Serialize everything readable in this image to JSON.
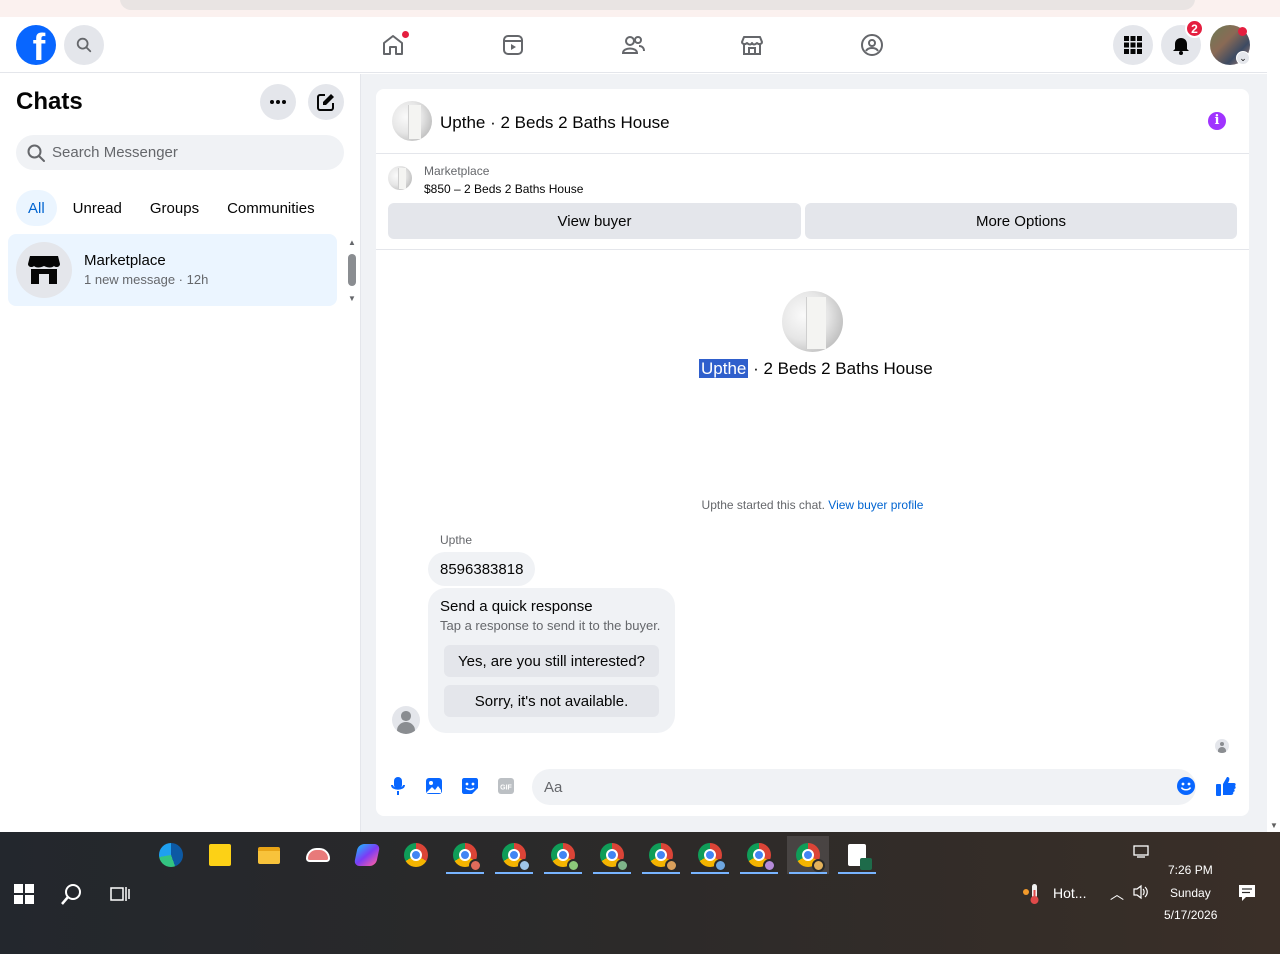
{
  "topnav": {
    "notification_count": "2"
  },
  "chats": {
    "title": "Chats",
    "search_placeholder": "Search Messenger",
    "filters": [
      "All",
      "Unread",
      "Groups",
      "Communities"
    ],
    "active_filter": "All",
    "items": [
      {
        "name": "Marketplace",
        "preview": "1 new message",
        "time": "12h"
      }
    ]
  },
  "conversation": {
    "title": "Upthe · 2 Beds 2 Baths House",
    "banner": {
      "label": "Marketplace",
      "listing": "$850 – 2 Beds 2 Baths House",
      "view_buyer": "View buyer",
      "more_options": "More Options"
    },
    "center": {
      "name_highlight": "Upthe",
      "name_rest": " · 2 Beds 2 Baths House"
    },
    "started_text": "Upthe started this chat.",
    "started_link": "View buyer profile",
    "sender": "Upthe",
    "message": "8596383818",
    "quick": {
      "title": "Send a quick response",
      "subtitle": "Tap a response to send it to the buyer.",
      "option1": "Yes, are you still interested?",
      "option2": "Sorry, it's not available."
    },
    "composer_placeholder": "Aa"
  },
  "taskbar": {
    "weather": "Hot...",
    "time": "7:26 PM",
    "day": "Sunday",
    "date": "5/17/2026"
  },
  "colors": {
    "facebook_blue": "#0866ff",
    "active_tab_bg": "#ebf5ff",
    "link_blue": "#0064d1",
    "notification_red": "#e41e3f",
    "info_purple": "#a033ff"
  }
}
